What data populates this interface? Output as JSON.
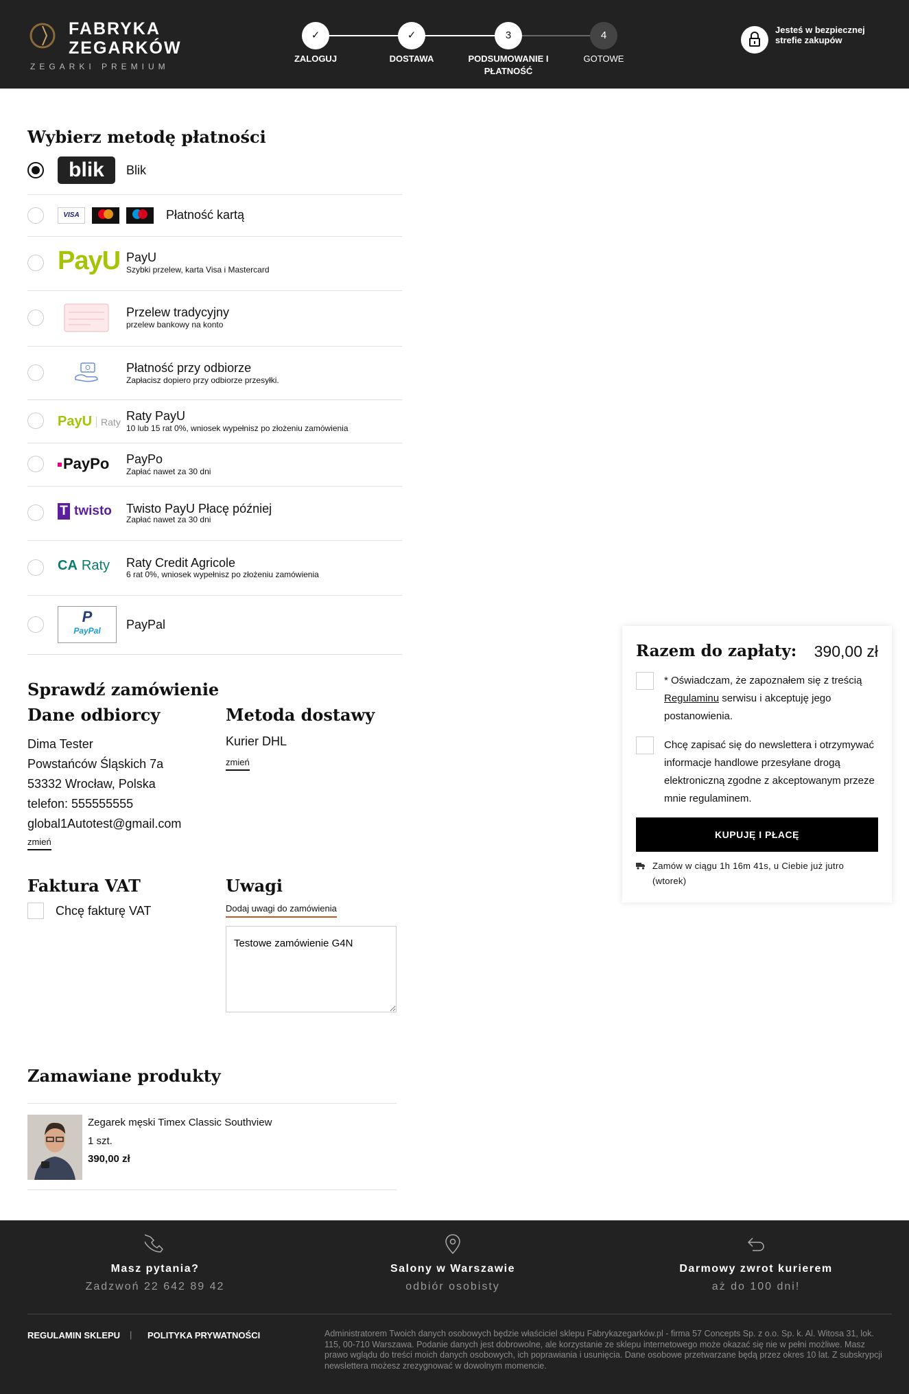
{
  "header": {
    "brand_line1": "FABRYKA",
    "brand_line2": "ZEGARKÓW",
    "brand_tagline": "ZEGARKI PREMIUM",
    "steps": [
      {
        "label": "ZALOGUJ",
        "state": "done",
        "mark": "✓"
      },
      {
        "label": "DOSTAWA",
        "state": "done",
        "mark": "✓"
      },
      {
        "label": "PODSUMOWANIE I PŁATNOŚĆ",
        "state": "current",
        "mark": "3"
      },
      {
        "label": "GOTOWE",
        "state": "pending",
        "mark": "4"
      }
    ],
    "secure_text": "Jesteś w bezpiecznej strefie zakupów"
  },
  "payment": {
    "title": "Wybierz metodę płatności",
    "methods": [
      {
        "name": "Blik",
        "desc": "",
        "selected": true,
        "logo": "blik-logo"
      },
      {
        "name": "Płatność kartą",
        "desc": "",
        "selected": false,
        "logo": "card-logos",
        "card_labels": [
          "VISA",
          "mastercard",
          "maestro"
        ]
      },
      {
        "name": "PayU",
        "desc": "Szybki przelew, karta Visa i Mastercard",
        "selected": false,
        "logo": "payu-logo",
        "logo_text": "PayU"
      },
      {
        "name": "Przelew tradycyjny",
        "desc": "przelew bankowy na konto",
        "selected": false,
        "logo": "bank-transfer-icon"
      },
      {
        "name": "Płatność przy odbiorze",
        "desc": "Zapłacisz dopiero przy odbiorze przesyłki.",
        "selected": false,
        "logo": "cash-on-delivery-icon"
      },
      {
        "name": "Raty PayU",
        "desc": "10 lub 15 rat 0%, wniosek wypełnisz po złożeniu zamówienia",
        "selected": false,
        "logo": "payu-raty-logo",
        "logo_text": "PayU",
        "logo_sub": "Raty"
      },
      {
        "name": "PayPo",
        "desc": "Zapłać nawet za 30 dni",
        "selected": false,
        "logo": "paypo-logo",
        "logo_text": "PayPo"
      },
      {
        "name": "Twisto PayU Płacę później",
        "desc": "Zapłać nawet za 30 dni",
        "selected": false,
        "logo": "twisto-logo",
        "logo_text": "twisto"
      },
      {
        "name": "Raty Credit Agricole",
        "desc": "6 rat 0%, wniosek wypełnisz po złożeniu zamówienia",
        "selected": false,
        "logo": "credit-agricole-logo",
        "logo_text": "Raty"
      },
      {
        "name": "PayPal",
        "desc": "",
        "selected": false,
        "logo": "paypal-logo",
        "logo_text": "PayPal"
      }
    ]
  },
  "review": {
    "title": "Sprawdź zamówienie",
    "recipient_title": "Dane odbiorcy",
    "recipient_lines": [
      "Dima Tester",
      "Powstańców Śląskich 7a",
      "53332 Wrocław, Polska",
      "telefon: 555555555",
      "global1Autotest@gmail.com"
    ],
    "change_label": "zmień",
    "delivery_title": "Metoda dostawy",
    "delivery_method": "Kurier DHL",
    "vat_title": "Faktura VAT",
    "vat_label": "Chcę fakturę VAT",
    "notes_title": "Uwagi",
    "notes_tab": "Dodaj uwagi do zamówienia",
    "notes_value": "Testowe zamówienie G4N"
  },
  "products": {
    "title": "Zamawiane produkty",
    "items": [
      {
        "name": "Zegarek męski Timex Classic Southview",
        "qty": "1 szt.",
        "price": "390,00 zł"
      }
    ]
  },
  "summary": {
    "total_label": "Razem do zapłaty:",
    "total_value": "390,00 zł",
    "consent_pre": "* Oświadczam, że zapoznałem się z treścią ",
    "consent_link": "Regulaminu",
    "consent_post": " serwisu i akceptuję jego postanowienia.",
    "newsletter": "Chcę zapisać się do newslettera i otrzymywać informacje handlowe przesyłane drogą elektroniczną zgodne z akceptowanym przeze mnie regulaminem.",
    "buy_label": "KUPUJĘ I PŁACĘ",
    "shipping_note": "Zamów w ciągu 1h 16m 41s, u Ciebie już jutro (wtorek)"
  },
  "footer": {
    "cols": [
      {
        "title": "Masz pytania?",
        "sub": "Zadzwoń 22 642 89 42",
        "icon": "phone-icon"
      },
      {
        "title": "Salony w Warszawie",
        "sub": "odbiór osobisty",
        "icon": "location-pin-icon"
      },
      {
        "title": "Darmowy zwrot kurierem",
        "sub": "aż do 100 dni!",
        "icon": "return-arrow-icon"
      }
    ],
    "links": [
      "REGULAMIN SKLEPU",
      "POLITYKA PRYWATNOŚCI"
    ],
    "separator": "|",
    "legal": "Administratorem Twoich danych osobowych będzie właściciel sklepu Fabrykazegarków.pl - firma 57 Concepts Sp. z o.o. Sp. k. Al. Witosa 31, lok. 115, 00-710 Warszawa. Podanie danych jest dobrowolne, ale korzystanie ze sklepu internetowego może okazać się nie w pełni możliwe. Masz prawo wglądu do treści moich danych osobowych, ich poprawiania i usunięcia. Dane osobowe przetwarzane będą przez okres 10 lat. Z subskrypcji newslettera możesz zrezygnować w dowolnym momencie."
  }
}
